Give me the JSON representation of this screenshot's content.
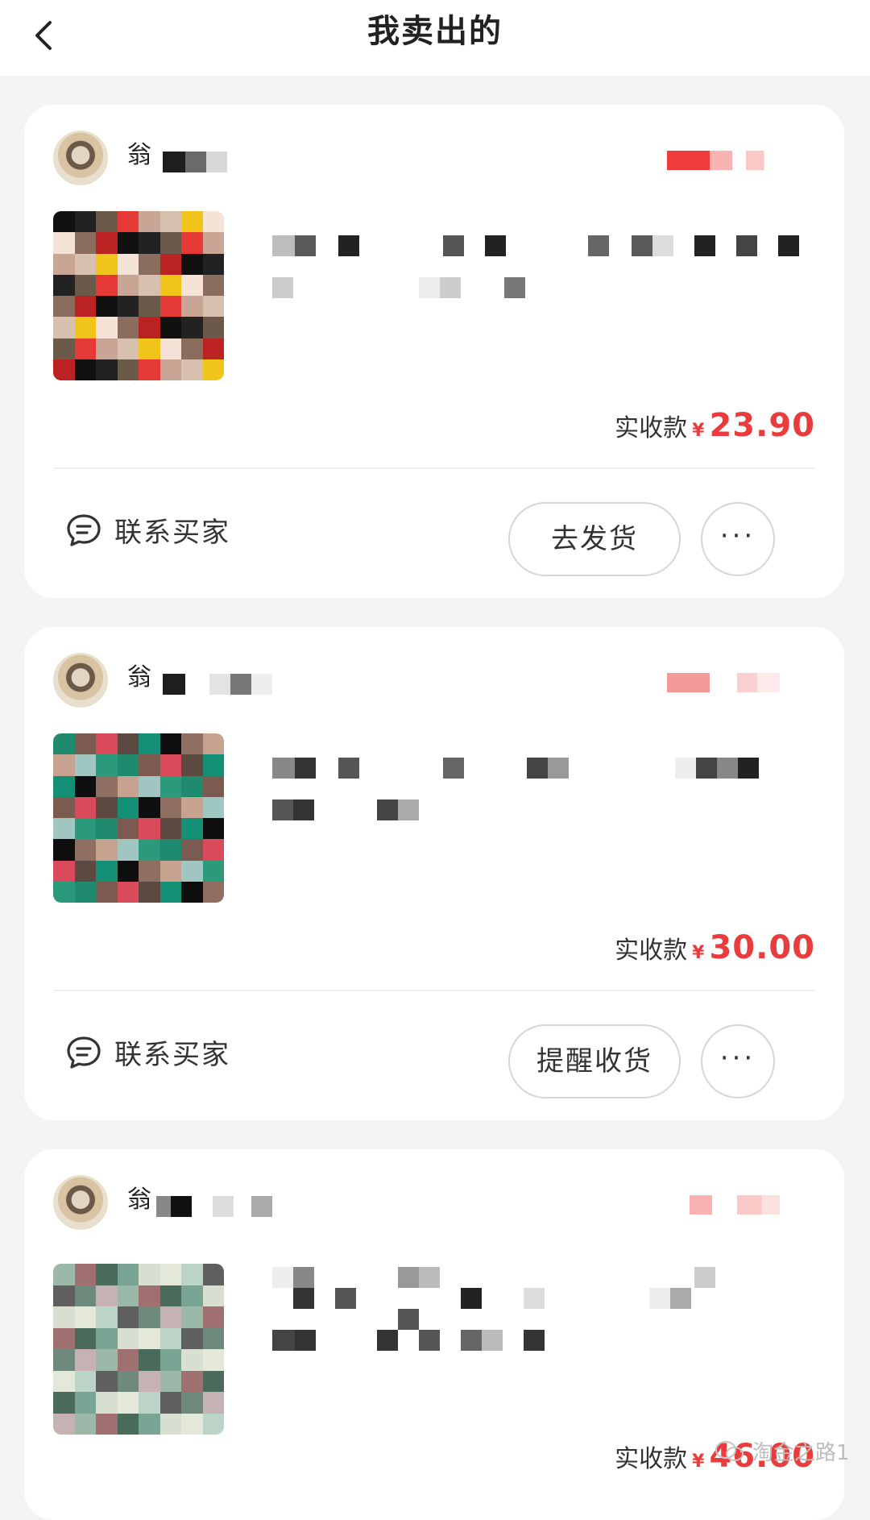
{
  "header": {
    "title": "我卖出的"
  },
  "orders": [
    {
      "seller_name": "翁",
      "price_label": "实收款",
      "currency": "¥",
      "price": "23.90",
      "contact_label": "联系买家",
      "action_label": "去发货",
      "more_label": "···"
    },
    {
      "seller_name": "翁",
      "price_label": "实收款",
      "currency": "¥",
      "price": "30.00",
      "contact_label": "联系买家",
      "action_label": "提醒收货",
      "more_label": "···"
    },
    {
      "seller_name": "翁",
      "price_label": "实收款",
      "currency": "¥",
      "price": "46.00"
    }
  ],
  "watermark": {
    "text": "淘金之路1"
  },
  "colors": {
    "price": "#ea3c3c",
    "background": "#f3f3f3",
    "card": "#ffffff"
  }
}
